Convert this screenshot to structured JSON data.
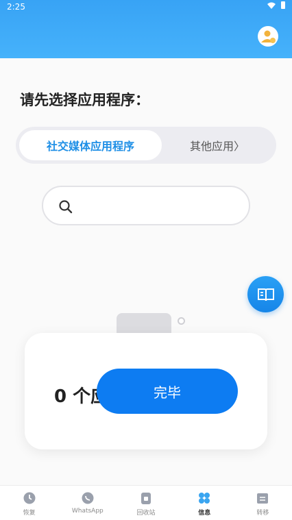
{
  "status_bar": {
    "time": "2:25"
  },
  "page": {
    "prompt_title": "请先选择应用程序：",
    "tabs": [
      {
        "label": "社交媒体应用程序",
        "active": true
      },
      {
        "label": "其他应用〉",
        "active": false
      }
    ],
    "search": {
      "value": "",
      "placeholder": ""
    },
    "result_card": {
      "count_text": "0 个应用",
      "done_label": "完毕"
    }
  },
  "bottom_nav": {
    "items": [
      {
        "label": "恢复",
        "icon": "clock-icon"
      },
      {
        "label": "WhatsApp",
        "icon": "whatsapp-icon"
      },
      {
        "label": "回收站",
        "icon": "trash-icon"
      },
      {
        "label": "信息",
        "icon": "grid-icon",
        "active": true
      },
      {
        "label": "转移",
        "icon": "transfer-icon"
      }
    ]
  },
  "colors": {
    "header": "#3da9f8",
    "accent": "#1e8fe6",
    "done_button": "#0d7cf2"
  }
}
